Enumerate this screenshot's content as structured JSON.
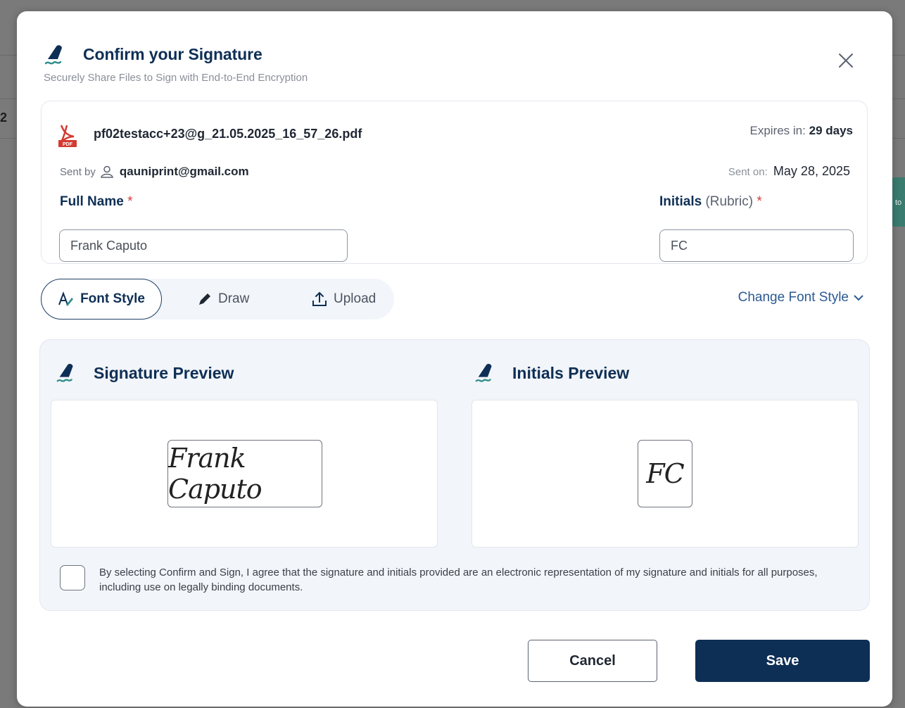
{
  "background": {
    "fragment_left": "2",
    "fragment_right": "to"
  },
  "modal": {
    "title": "Confirm your Signature",
    "subtitle": "Securely Share Files to Sign with End-to-End Encryption"
  },
  "file": {
    "name": "pf02testacc+23@g_21.05.2025_16_57_26.pdf",
    "expires_label": "Expires in:",
    "expires_value": "29 days",
    "sent_by_label": "Sent by",
    "sent_by_email": "qauniprint@gmail.com",
    "sent_on_label": "Sent on:",
    "sent_on_value": "May 28, 2025"
  },
  "fields": {
    "full_name_label": "Full Name",
    "full_name_value": "Frank Caputo",
    "initials_label": "Initials",
    "initials_sub": "(Rubric)",
    "initials_value": "FC",
    "required_mark": "*"
  },
  "tabs": {
    "font_style": "Font Style",
    "draw": "Draw",
    "upload": "Upload",
    "change_font_style": "Change Font Style"
  },
  "preview": {
    "signature_title": "Signature Preview",
    "signature_text": "Frank Caputo",
    "initials_title": "Initials Preview",
    "initials_text": "FC",
    "agreement": "By selecting Confirm and Sign, I agree that the signature and initials provided are an electronic representation of my signature and initials for all purposes, including use on legally binding documents."
  },
  "buttons": {
    "cancel": "Cancel",
    "save": "Save"
  },
  "colors": {
    "primary": "#0e2f55",
    "link": "#2b5a93",
    "required": "#d63b3b",
    "accent_teal": "#2f8f8a"
  }
}
